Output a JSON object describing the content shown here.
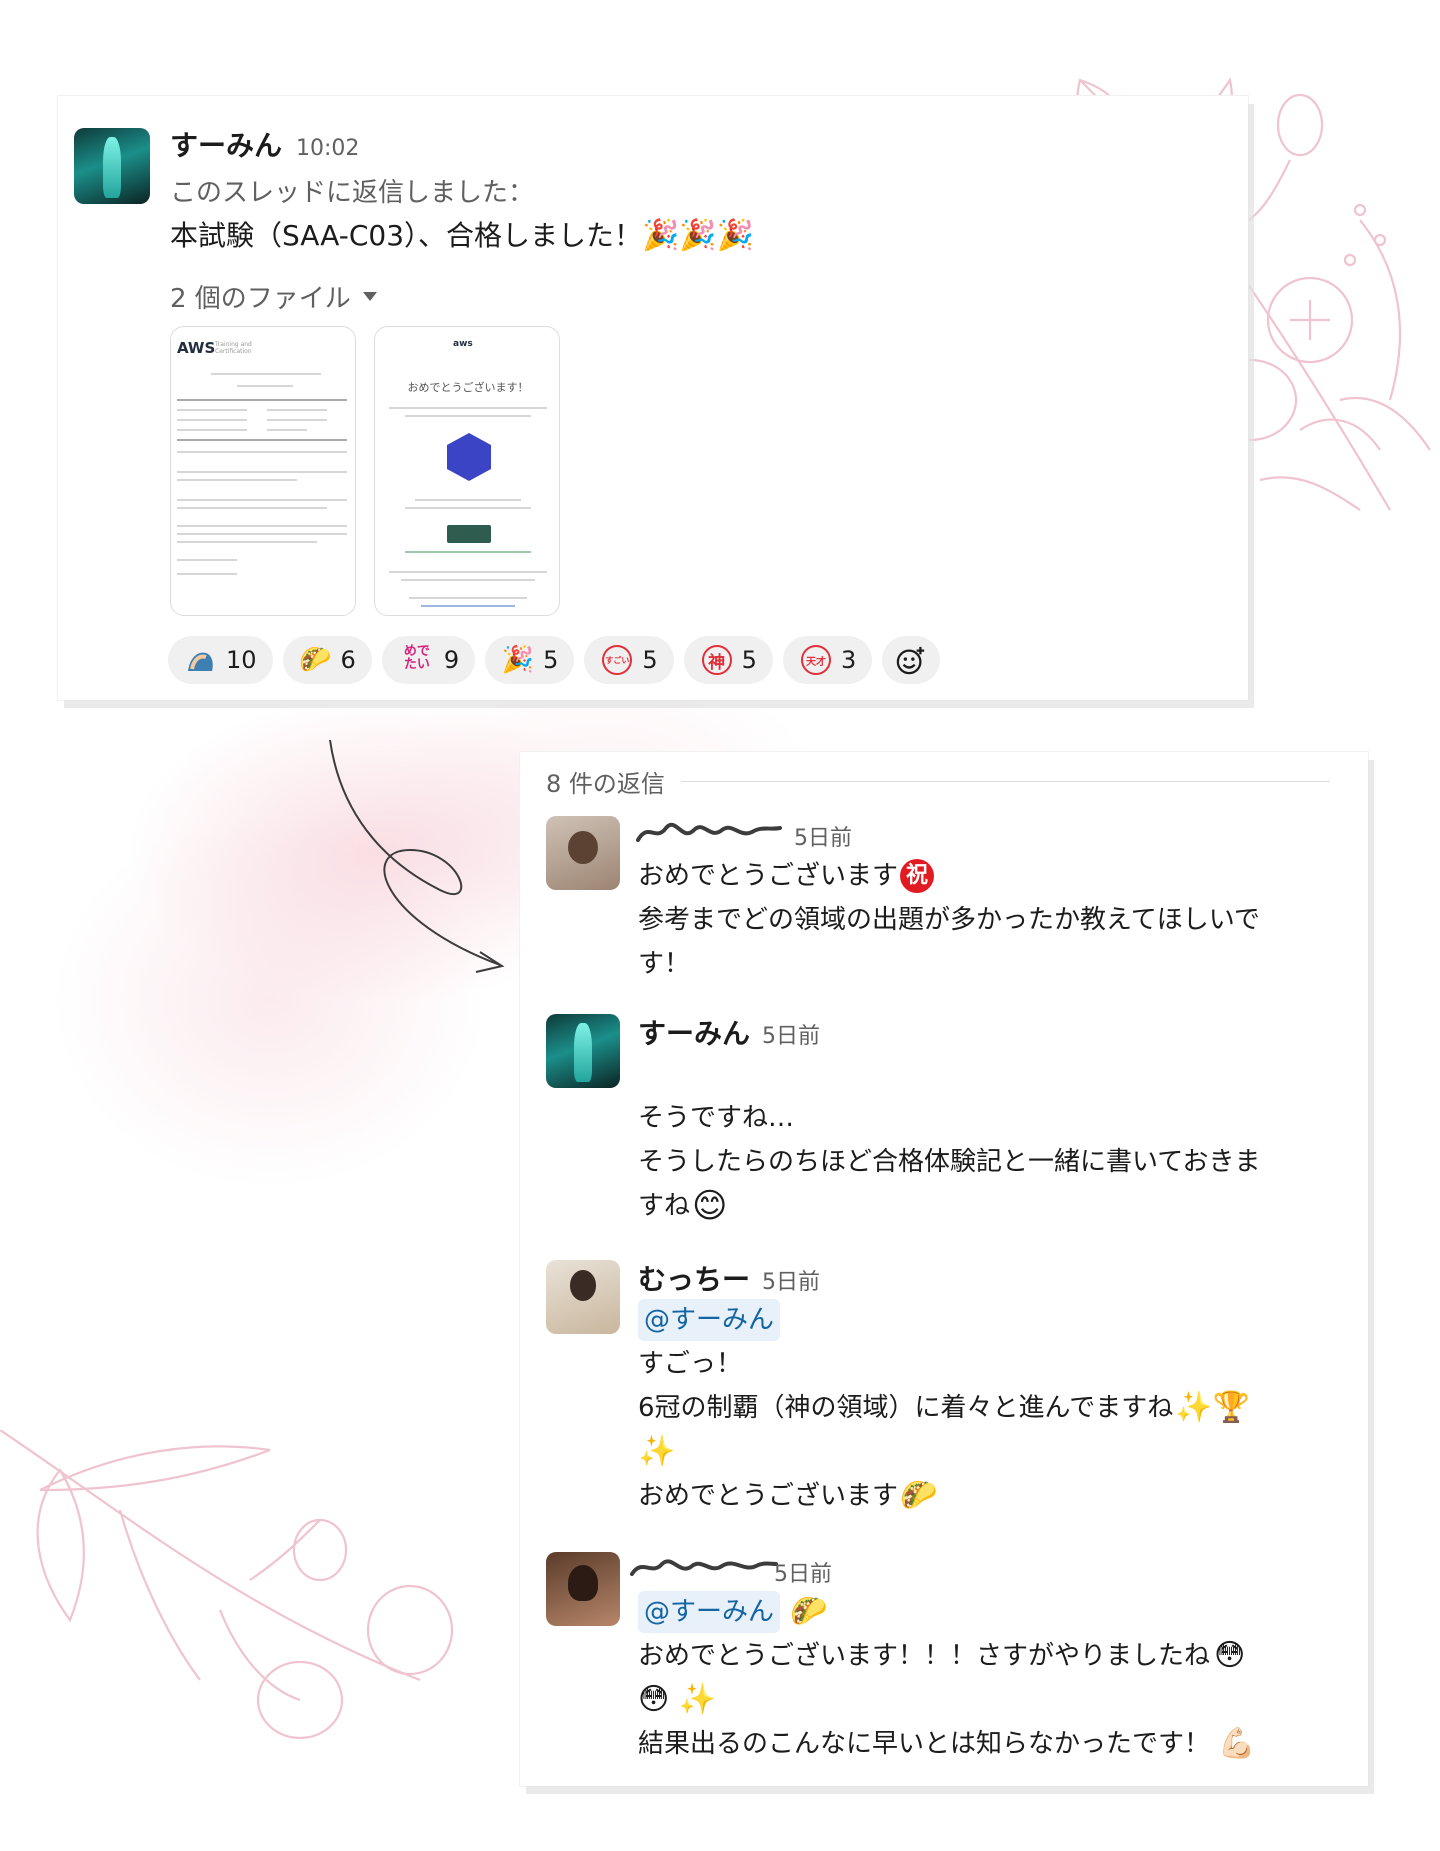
{
  "thread": {
    "author": "すーみん",
    "time": "10:02",
    "reply_note": "このスレッドに返信しました：",
    "message": "本試験（SAA-C03）、合格しました！",
    "files_label": "2 個のファイル",
    "thumbnail1": {
      "logo": "AWS",
      "logo_sub": "Training and Certification"
    },
    "thumbnail2": {
      "logo": "aws",
      "heading": "おめでとうございます！"
    },
    "reactions": [
      {
        "icon": "raised-hands",
        "count": "10"
      },
      {
        "icon": "taco",
        "count": "6"
      },
      {
        "icon": "medetai",
        "label": "めでたい",
        "count": "9"
      },
      {
        "icon": "tada",
        "count": "5"
      },
      {
        "icon": "sugoi",
        "label": "すごい",
        "count": "5"
      },
      {
        "icon": "kami",
        "label": "神",
        "count": "5"
      },
      {
        "icon": "tensai",
        "label": "天才",
        "count": "3"
      }
    ]
  },
  "replies": {
    "header": "8 件の返信",
    "items": [
      {
        "time": "5日前",
        "lines": [
          "おめでとうございます",
          "参考までどの領域の出題が多かったか教えてほしいで",
          "す！"
        ],
        "emoji_shuku": "祝"
      },
      {
        "author": "すーみん",
        "time": "5日前",
        "lines": [
          "そうですね…",
          "そうしたらのちほど合格体験記と一緒に書いておきま",
          "すね"
        ]
      },
      {
        "author": "むっちー",
        "time": "5日前",
        "mention": "@すーみん",
        "lines": [
          "すごっ！",
          "6冠の制覇（神の領域）に着々と進んでますね",
          "おめでとうございます"
        ]
      },
      {
        "time": "5日前",
        "mention": "@すーみん",
        "lines": [
          "おめでとうございます！！！さすがやりましたね",
          "結果出るのこんなに早いとは知らなかったです！"
        ]
      }
    ]
  },
  "colors": {
    "floral": "#efc3cf",
    "mention_bg": "#e8f1fa",
    "mention_text": "#1264a3",
    "reaction_bg": "#f0f0f0"
  }
}
